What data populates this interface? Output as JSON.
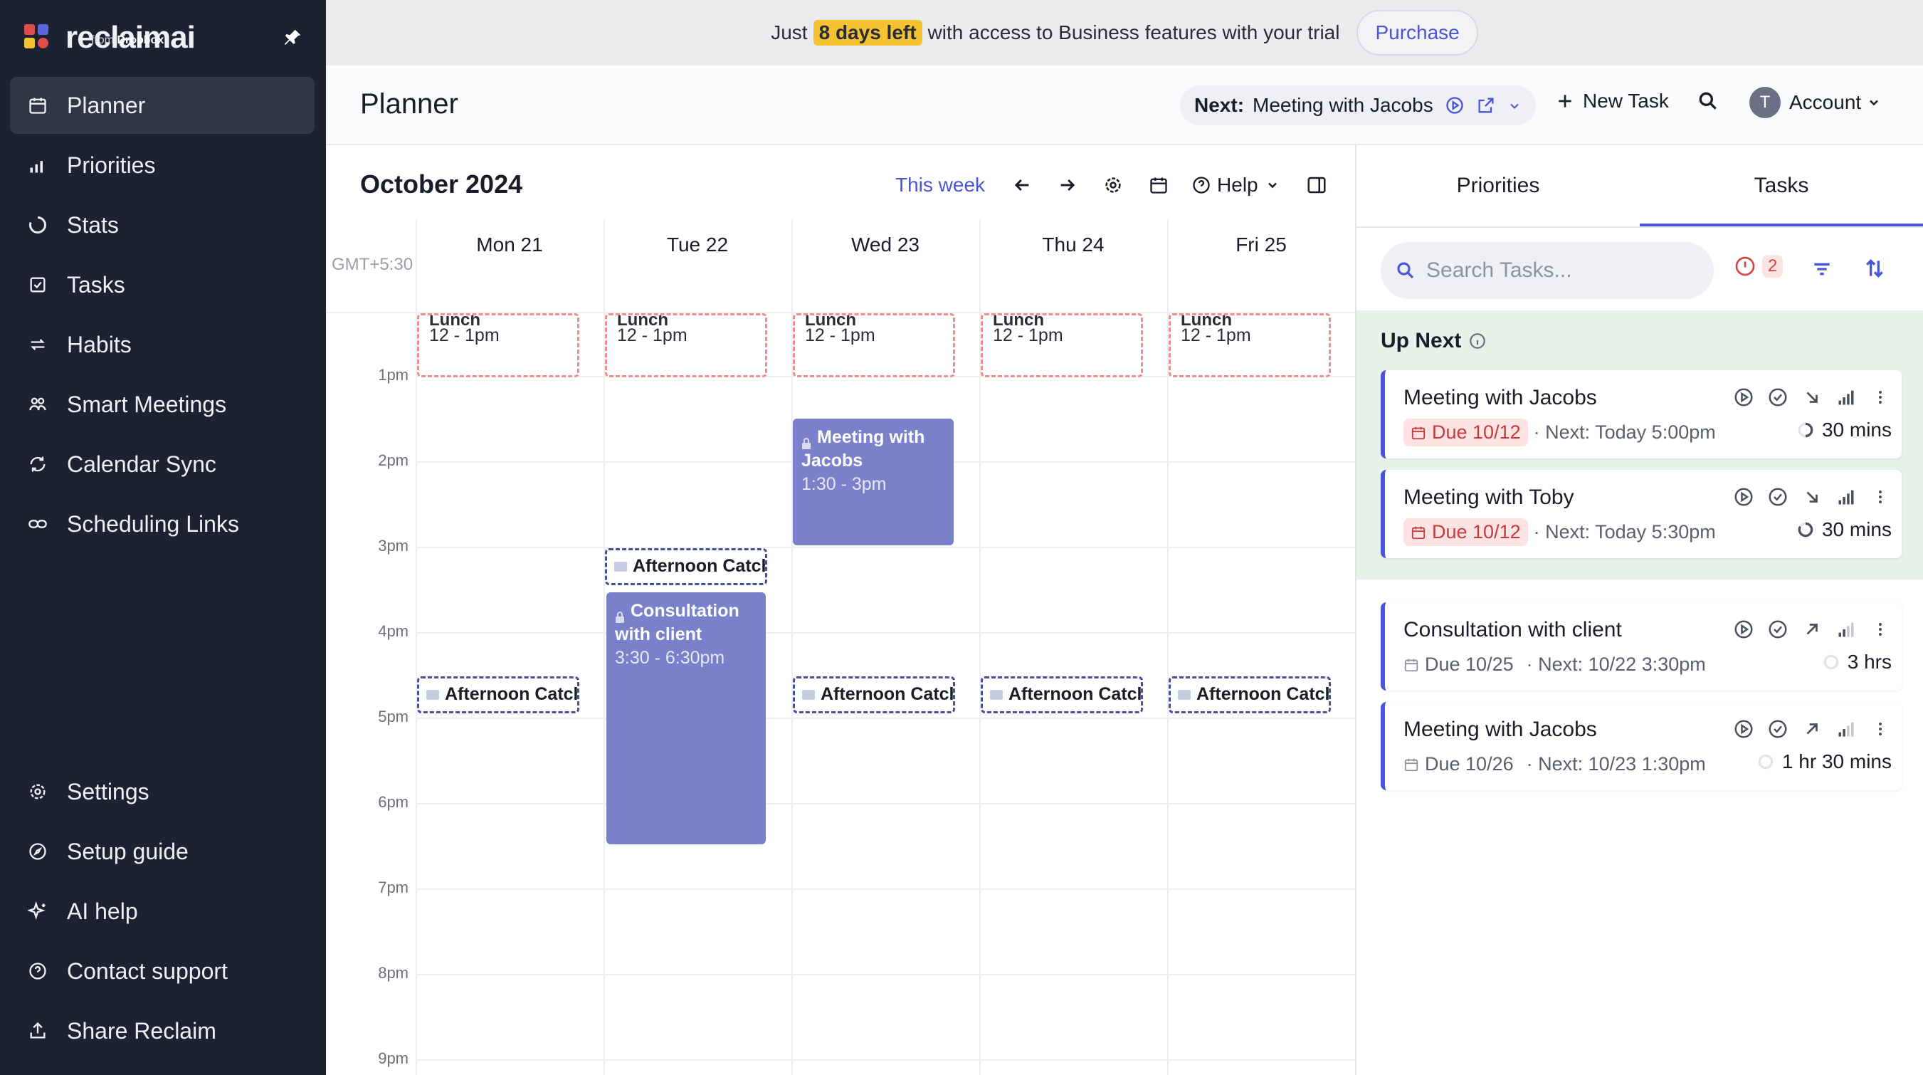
{
  "brand": {
    "name": "reclaimai",
    "sub_prefix": "from",
    "sub_brand": "Dropbox"
  },
  "sidebar": {
    "items": [
      {
        "label": "Planner",
        "icon": "calendar-icon",
        "active": true
      },
      {
        "label": "Priorities",
        "icon": "bars-icon"
      },
      {
        "label": "Stats",
        "icon": "ring-icon"
      },
      {
        "label": "Tasks",
        "icon": "checkbox-icon"
      },
      {
        "label": "Habits",
        "icon": "repeat-icon"
      },
      {
        "label": "Smart Meetings",
        "icon": "people-icon"
      },
      {
        "label": "Calendar Sync",
        "icon": "sync-icon"
      },
      {
        "label": "Scheduling Links",
        "icon": "link-icon"
      }
    ],
    "bottom": [
      {
        "label": "Settings",
        "icon": "gear-icon"
      },
      {
        "label": "Setup guide",
        "icon": "compass-icon"
      },
      {
        "label": "AI help",
        "icon": "sparkle-icon"
      },
      {
        "label": "Contact support",
        "icon": "help-icon"
      },
      {
        "label": "Share Reclaim",
        "icon": "share-icon"
      }
    ]
  },
  "banner": {
    "pre": "Just",
    "highlight": "8 days left",
    "post": "with access to Business features with your trial",
    "button": "Purchase"
  },
  "header": {
    "title": "Planner",
    "next_label": "Next:",
    "next_value": "Meeting with Jacobs",
    "new_task": "New Task",
    "account": "Account",
    "avatar": "T"
  },
  "calendar": {
    "month": "October 2024",
    "this_week": "This week",
    "help": "Help",
    "timezone": "GMT+5:30",
    "days": [
      "Mon 21",
      "Tue 22",
      "Wed 23",
      "Thu 24",
      "Fri 25"
    ],
    "hours": [
      "1pm",
      "2pm",
      "3pm",
      "4pm",
      "5pm",
      "6pm",
      "7pm",
      "8pm",
      "9pm"
    ],
    "lunch_title": "Lunch",
    "lunch_time": "12 - 1pm",
    "afternoon_title": "Afternoon Catch up",
    "meeting_jacobs": {
      "title": "Meeting with Jacobs",
      "time": "1:30 - 3pm"
    },
    "consultation": {
      "title": "Consultation with client",
      "time": "3:30 - 6:30pm"
    }
  },
  "panel": {
    "tabs": [
      "Priorities",
      "Tasks"
    ],
    "search_placeholder": "Search Tasks...",
    "alert_count": "2",
    "up_next": "Up Next",
    "tasks": [
      {
        "title": "Meeting with Jacobs",
        "due": "Due 10/12",
        "next": "· Next: Today 5:00pm",
        "duration": "30 mins",
        "overdue": true
      },
      {
        "title": "Meeting with Toby",
        "due": "Due 10/12",
        "next": "· Next: Today 5:30pm",
        "duration": "30 mins",
        "overdue": true
      },
      {
        "title": "Consultation with client",
        "due": "Due 10/25",
        "next": "· Next: 10/22 3:30pm",
        "duration": "3 hrs",
        "overdue": false
      },
      {
        "title": "Meeting with Jacobs",
        "due": "Due 10/26",
        "next": "· Next: 10/23 1:30pm",
        "duration": "1 hr 30 mins",
        "overdue": false
      }
    ]
  },
  "colors": {
    "sidebar": "#1c2231",
    "accent": "#4a54d6",
    "event": "#7a80c9",
    "lunch_border": "#f08f8f",
    "highlight": "#f5c332"
  }
}
